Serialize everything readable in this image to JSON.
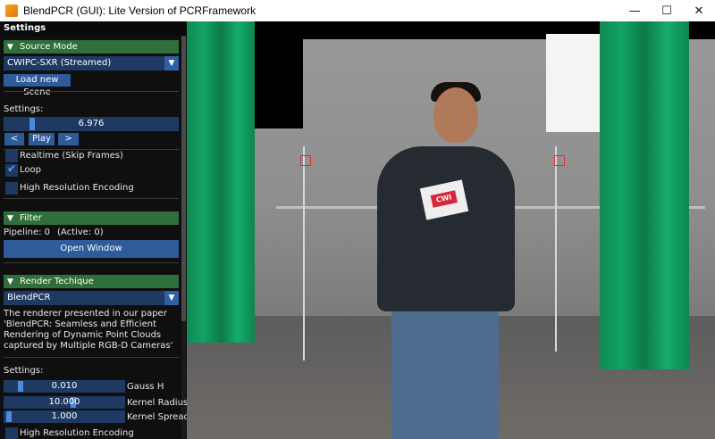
{
  "window": {
    "title": "BlendPCR (GUI): Lite Version of PCRFramework",
    "minimize": "—",
    "maximize": "☐",
    "close": "✕"
  },
  "panel": {
    "header": "Settings",
    "source_mode": {
      "section_label": "Source Mode",
      "combo_value": "CWIPC-SXR (Streamed)",
      "load_button": "Load new Scene",
      "settings_label": "Settings:",
      "frame_value": "6.976",
      "frame_fraction": 0.15,
      "prev_button": "<",
      "play_button": "Play",
      "next_button": ">",
      "realtime_label": "Realtime (Skip Frames)",
      "realtime_checked": false,
      "loop_label": "Loop",
      "loop_checked": true,
      "hires_label": "High Resolution Encoding",
      "hires_checked": false
    },
    "filter": {
      "section_label": "Filter",
      "pipeline_text": "Pipeline: 0",
      "active_text": "(Active: 0)",
      "open_window_button": "Open Window"
    },
    "render": {
      "section_label": "Render Techique",
      "combo_value": "BlendPCR",
      "description": "The renderer presented in our paper 'BlendPCR: Seamless and Efficient Rendering of Dynamic Point Clouds captured by Multiple RGB-D Cameras'",
      "settings_label": "Settings:",
      "sliders": [
        {
          "value": "0.010",
          "label": "Gauss H",
          "fraction": 0.12
        },
        {
          "value": "10.000",
          "label": "Kernel Radius",
          "fraction": 0.58
        },
        {
          "value": "1.000",
          "label": "Kernel Spread",
          "fraction": 0.02
        }
      ],
      "hires_label": "High Resolution Encoding"
    }
  },
  "viewport": {
    "logo_text": "CWI"
  },
  "colors": {
    "section_green": "#2f6f3a",
    "widget_blue": "#1e3a63",
    "button_blue": "#2e5b9a",
    "curtain_green": "#13a365"
  }
}
